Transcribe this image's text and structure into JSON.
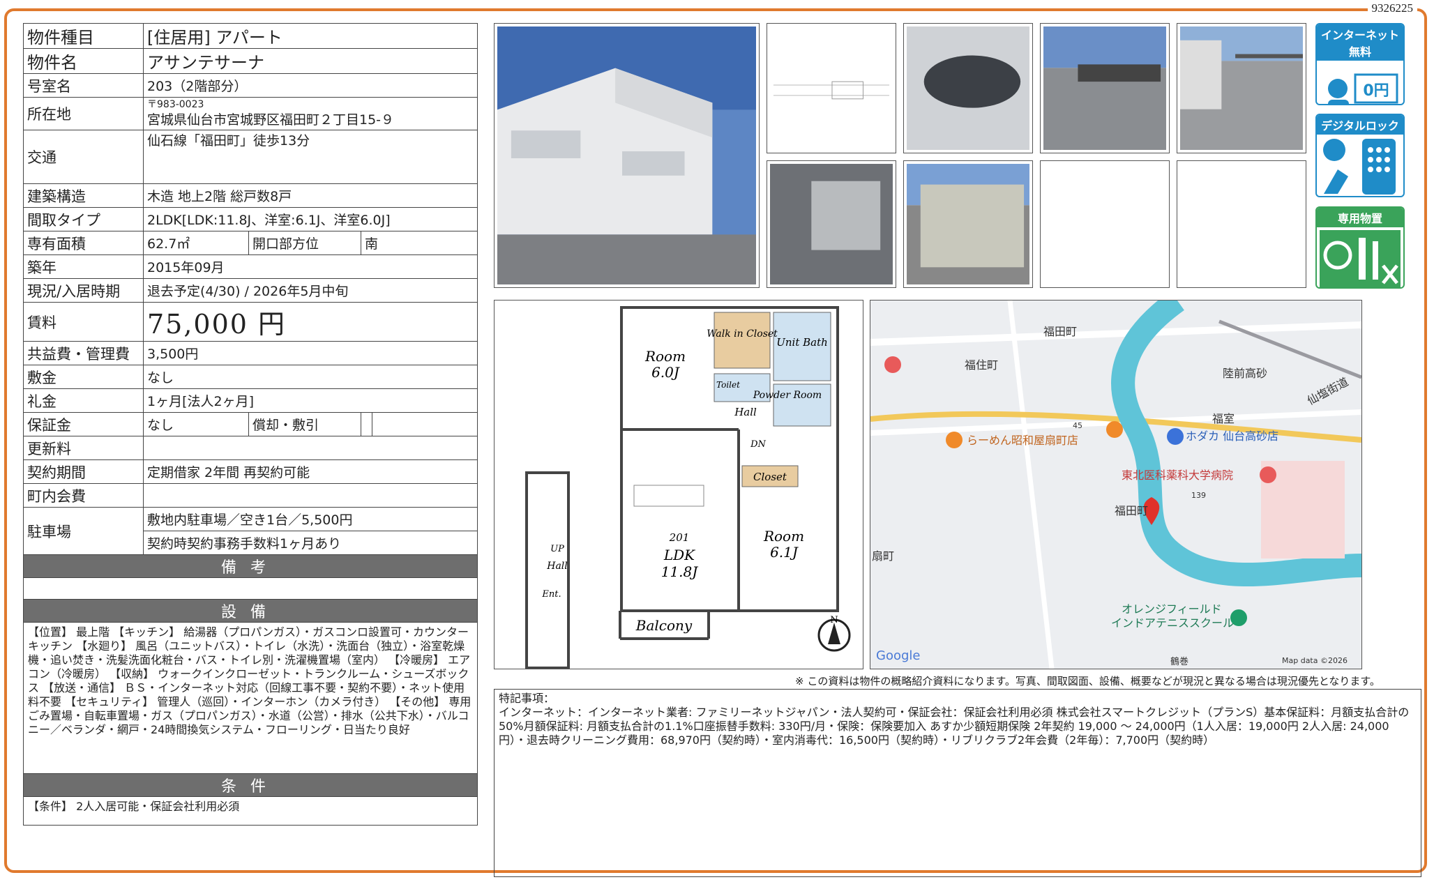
{
  "doc_id": "9326225",
  "rows": {
    "type_label": "物件種目",
    "type_value": "[住居用]  アパート",
    "name_label": "物件名",
    "name_value": "アサンテサーナ",
    "room_label": "号室名",
    "room_value": "203（2階部分）",
    "addr_label": "所在地",
    "addr_zip": "〒983-0023",
    "addr_value": "宮城県仙台市宮城野区福田町２丁目15-９",
    "transport_label": "交通",
    "transport_value": "仙石線「福田町」徒歩13分",
    "structure_label": "建築構造",
    "structure_value": "木造  地上2階  総戸数8戸",
    "layout_label": "間取タイプ",
    "layout_value": "2LDK[LDK:11.8J、洋室:6.1J、洋室6.0J]",
    "area_label": "専有面積",
    "area_value": "62.7㎡",
    "dir_label": "開口部方位",
    "dir_value": "南",
    "built_label": "築年",
    "built_value": "2015年09月",
    "status_label": "現況/入居時期",
    "status_value": "退去予定(4/30)  /  2026年5月中旬",
    "rent_label": "賃料",
    "rent_value": "75,000 円",
    "fee_label": "共益費・管理費",
    "fee_value": "3,500円",
    "deposit_label": "敷金",
    "deposit_value": "なし",
    "key_label": "礼金",
    "key_value": "1ヶ月[法人2ヶ月]",
    "guar_label": "保証金",
    "guar_value": "なし",
    "amort_label": "償却・敷引",
    "amort_value": "",
    "renew_label": "更新料",
    "renew_value": "",
    "contract_label": "契約期間",
    "contract_value": "定期借家 2年間  再契約可能",
    "town_label": "町内会費",
    "town_value": "",
    "parking_label": "駐車場",
    "parking_value1": "敷地内駐車場／空き1台／5,500円",
    "parking_value2": "契約時契約事務手数料1ヶ月あり"
  },
  "sections": {
    "bikou": "備考",
    "setsubi": "設備",
    "jouken": "条件"
  },
  "setsubi_text": "【位置】 最上階 【キッチン】 給湯器（プロパンガス）・ガスコンロ設置可・カウンターキッチン 【水廻り】 風呂（ユニットバス）・トイレ（水洗）・洗面台（独立）・浴室乾燥機・追い焚き・洗髪洗面化粧台・バス・トイレ別・洗濯機置場（室内） 【冷暖房】 エアコン（冷暖房） 【収納】 ウォークインクローゼット・トランクルーム・シューズボックス 【放送・通信】 ＢＳ・インターネット対応（回線工事不要・契約不要）・ネット使用料不要 【セキュリティ】 管理人（巡回）・インターホン（カメラ付き） 【その他】 専用ごみ置場・自転車置場・ガス（プロパンガス）・水道（公営）・排水（公共下水）・バルコニー／ベランダ・網戸・24時間換気システム・フローリング・日当たり良好",
  "jouken_text": "【条件】 2人入居可能・保証会社利用必須",
  "badges": {
    "internet": "インターネット無料",
    "internet_price": "0円",
    "digital": "デジタルロック",
    "storage": "専用物置"
  },
  "floorplan": {
    "room1": "Room",
    "room1_size": "6.0J",
    "walkin": "Walk in Closet",
    "unitbath": "Unit Bath",
    "toilet": "Toilet",
    "powder": "Powder Room",
    "hall": "Hall",
    "dn": "DN",
    "closet": "Closet",
    "ldk_no": "201",
    "ldk": "LDK",
    "ldk_size": "11.8J",
    "room2": "Room",
    "room2_size": "6.1J",
    "balcony": "Balcony",
    "up": "UP",
    "hall2": "Hall",
    "ent": "Ent.",
    "north": "N"
  },
  "map": {
    "l1": "福田町",
    "l2": "福住町",
    "l3": "陸前高砂",
    "l4": "仙塩街道",
    "l5": "福室",
    "l6": "45",
    "l7": "らーめん昭和屋扇町店",
    "l8": "ホダカ 仙台高砂店",
    "l9": "東北医科薬科大学病院",
    "l10": "139",
    "l11": "福田町",
    "l12": "扇町",
    "l13": "オレンジフィールド",
    "l14": "インドアテニススクール",
    "l15": "鶴巻",
    "google": "Google",
    "mapdata": "Map data ©2026"
  },
  "note": "※ この資料は物件の概略紹介資料になります。写真、間取図面、設備、概要などが現況と異なる場合は現況優先となります。",
  "remarks": "特記事項：\nインターネット：インターネット業者: ファミリーネットジャパン・法人契約可・保証会社：保証会社利用必須 株式会社スマートクレジット（プランS）基本保証料：月額支払合計の50%月額保証料: 月額支払合計の1.1%口座振替手数料: 330円/月・保険：保険要加入 あすか少額短期保険 2年契約 19,000 〜 24,000円（1人入居：19,000円 2人入居: 24,000円）・退去時クリーニング費用：68,970円（契約時）・室内消毒代：16,500円（契約時）・リブリクラブ2年会費（2年毎）：7,700円（契約時）",
  "colors": {
    "border": "#e07a2e",
    "section": "#6e6e6e",
    "badge": "#1f8cc8",
    "storage": "#3aa35a",
    "river": "#5fc4d8"
  }
}
